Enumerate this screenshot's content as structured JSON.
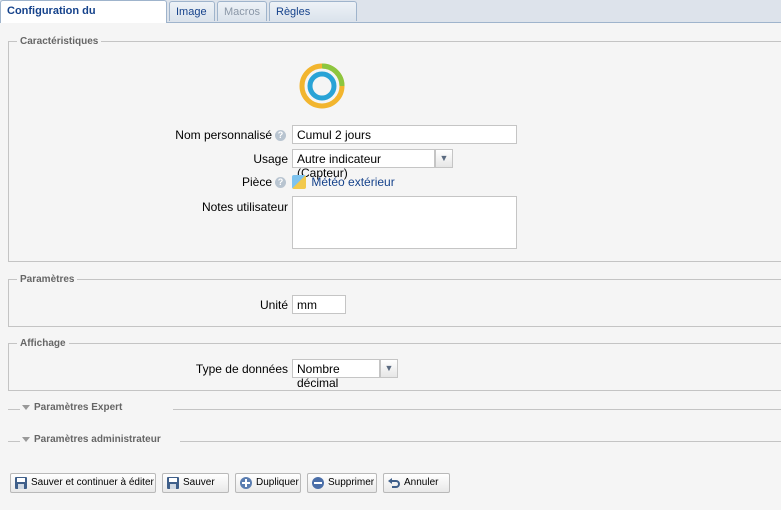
{
  "tabs": [
    {
      "label": "Configuration du périphérique",
      "state": "active"
    },
    {
      "label": "Image",
      "state": "normal"
    },
    {
      "label": "Macros",
      "state": "disabled"
    },
    {
      "label": "Règles associées",
      "state": "normal"
    }
  ],
  "caracteristiques": {
    "legend": "Caractéristiques",
    "device_icon": "donut-gauge-icon",
    "nom_label": "Nom personnalisé",
    "nom_value": "Cumul 2 jours",
    "usage_label": "Usage",
    "usage_value": "Autre indicateur (Capteur)",
    "piece_label": "Pièce",
    "piece_value": "Météo extérieur",
    "notes_label": "Notes utilisateur",
    "notes_value": ""
  },
  "parametres": {
    "legend": "Paramètres",
    "unite_label": "Unité",
    "unite_value": "mm"
  },
  "affichage": {
    "legend": "Affichage",
    "type_label": "Type de données",
    "type_value": "Nombre décimal"
  },
  "collapsed": {
    "expert": "Paramètres Expert",
    "admin": "Paramètres administrateur"
  },
  "buttons": {
    "save_continue": "Sauver et continuer à éditer",
    "save": "Sauver",
    "duplicate": "Dupliquer",
    "delete": "Supprimer",
    "cancel": "Annuler"
  },
  "colors": {
    "accent": "#15428b",
    "link": "#15428b"
  }
}
